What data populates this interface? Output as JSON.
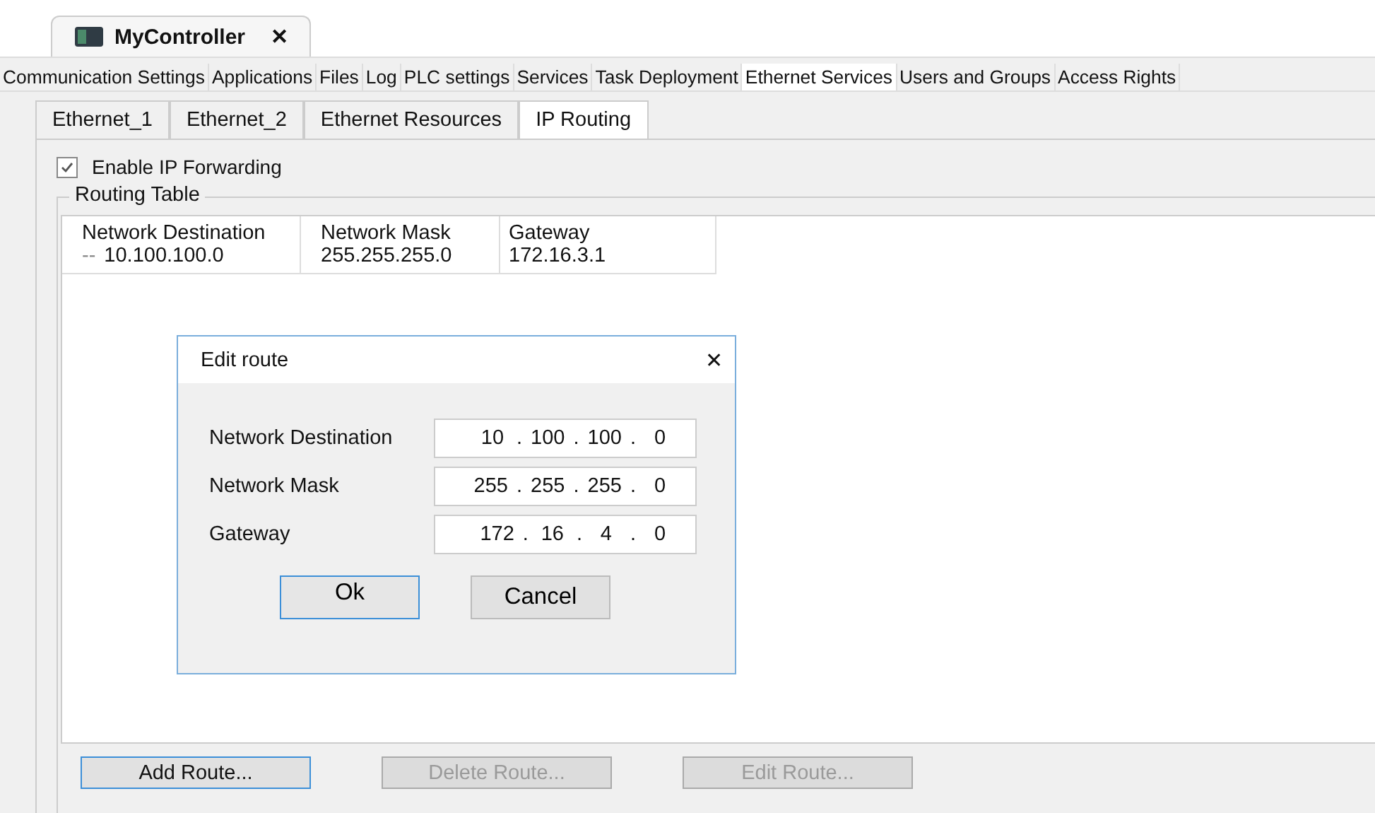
{
  "editor_tab": {
    "title": "MyController",
    "close": "✕"
  },
  "main_tabs": [
    {
      "label": "Communication Settings",
      "selected": false
    },
    {
      "label": "Applications",
      "selected": false
    },
    {
      "label": "Files",
      "selected": false
    },
    {
      "label": "Log",
      "selected": false
    },
    {
      "label": "PLC settings",
      "selected": false
    },
    {
      "label": "Services",
      "selected": false
    },
    {
      "label": "Task Deployment",
      "selected": false
    },
    {
      "label": "Ethernet Services",
      "selected": true
    },
    {
      "label": "Users and Groups",
      "selected": false
    },
    {
      "label": "Access Rights",
      "selected": false
    }
  ],
  "sub_tabs": [
    {
      "label": "Ethernet_1",
      "selected": false
    },
    {
      "label": "Ethernet_2",
      "selected": false
    },
    {
      "label": "Ethernet Resources",
      "selected": false
    },
    {
      "label": "IP Routing",
      "selected": true
    }
  ],
  "enable_forwarding": {
    "label": "Enable IP Forwarding",
    "checked": true
  },
  "routing_table": {
    "title": "Routing Table",
    "columns": [
      "Network Destination",
      "Network Mask",
      "Gateway"
    ],
    "rows": [
      {
        "marker": "--",
        "cells": [
          "10.100.100.0",
          "255.255.255.0",
          "172.16.3.1"
        ]
      }
    ]
  },
  "dialog": {
    "title": "Edit route",
    "close": "✕",
    "separator": ".",
    "fields": [
      {
        "label": "Network Destination",
        "octets": [
          "10",
          "100",
          "100",
          "0"
        ]
      },
      {
        "label": "Network Mask",
        "octets": [
          "255",
          "255",
          "255",
          "0"
        ]
      },
      {
        "label": "Gateway",
        "octets": [
          "172",
          "16",
          "4",
          "0"
        ]
      }
    ],
    "buttons": [
      {
        "label": "Ok",
        "focused": true
      },
      {
        "label": "Cancel",
        "focused": false
      }
    ]
  },
  "actions": [
    {
      "label": "Add Route...",
      "disabled": false,
      "focused": true
    },
    {
      "label": "Delete Route...",
      "disabled": true,
      "focused": false
    },
    {
      "label": "Edit Route...",
      "disabled": true,
      "focused": false
    }
  ]
}
